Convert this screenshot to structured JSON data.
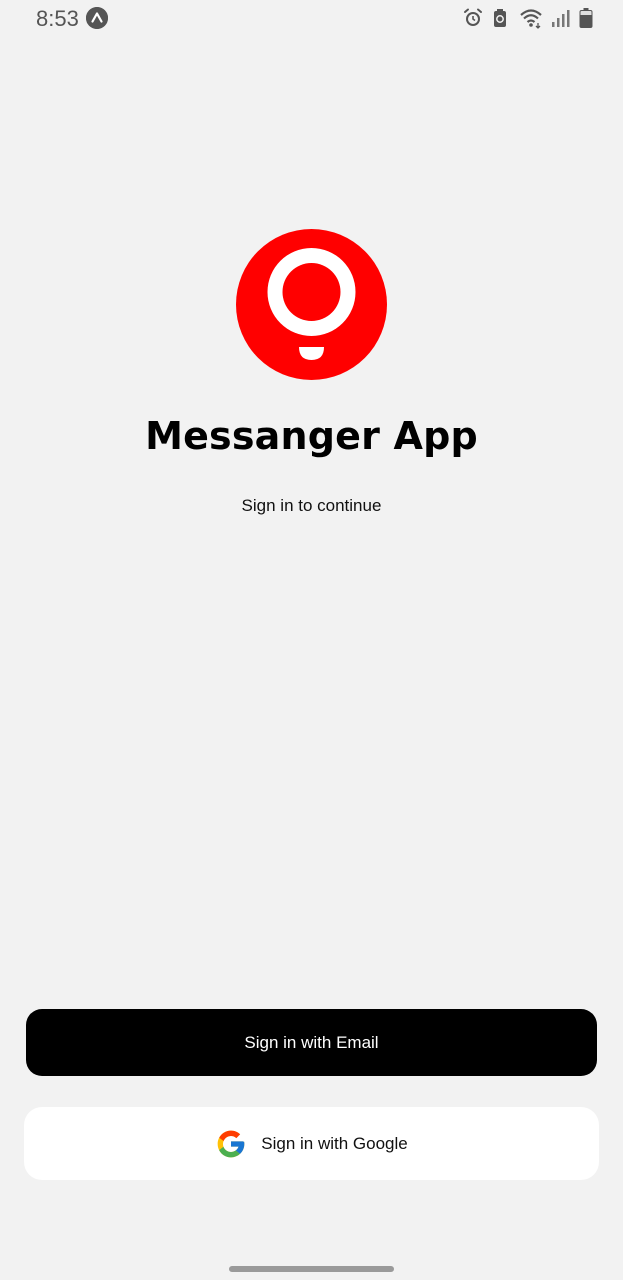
{
  "status_bar": {
    "time": "8:53",
    "icons": [
      "notification-app-icon",
      "alarm-icon",
      "sync-icon",
      "wifi-icon",
      "signal-icon",
      "battery-icon"
    ]
  },
  "app": {
    "title": "Messanger App",
    "subtitle": "Sign in to continue",
    "brand_color": "#ff0000",
    "logo_icon": "location-pin-bubble-icon"
  },
  "buttons": {
    "email_label": "Sign in with Email",
    "google_label": "Sign in with Google"
  }
}
